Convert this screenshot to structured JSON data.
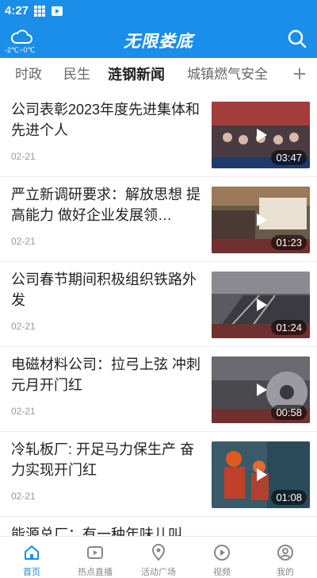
{
  "status_bar": {
    "time": "4:27"
  },
  "header": {
    "brand": "无限娄底",
    "weather": "-2℃~0℃"
  },
  "tabs": [
    "时政",
    "民生",
    "涟钢新闻",
    "城镇燃气安全"
  ],
  "articles": [
    {
      "title": "公司表彰2023年度先进集体和先进个人",
      "date": "02-21",
      "duration": "03:47"
    },
    {
      "title": "严立新调研要求：解放思想 提高能力 做好企业发展领…",
      "date": "02-21",
      "duration": "01:23"
    },
    {
      "title": "公司春节期间积极组织铁路外发",
      "date": "02-21",
      "duration": "01:24"
    },
    {
      "title": "电磁材料公司：拉弓上弦 冲刺元月开门红",
      "date": "02-21",
      "duration": "00:58"
    },
    {
      "title": "冷轧板厂: 开足马力保生产 奋力实现开门红",
      "date": "02-21",
      "duration": "01:08"
    },
    {
      "title": "能源总厂：有一种年味儿叫",
      "date": "",
      "duration": ""
    }
  ],
  "bottom_nav": [
    {
      "label": "首页",
      "icon": "home-icon"
    },
    {
      "label": "热点直播",
      "icon": "live-tv-icon"
    },
    {
      "label": "活动广场",
      "icon": "location-pin-icon"
    },
    {
      "label": "视频",
      "icon": "video-play-icon"
    },
    {
      "label": "我的",
      "icon": "user-icon"
    }
  ],
  "colors": {
    "primary": "#1a8ee9",
    "text": "#222222",
    "muted": "#999999"
  }
}
